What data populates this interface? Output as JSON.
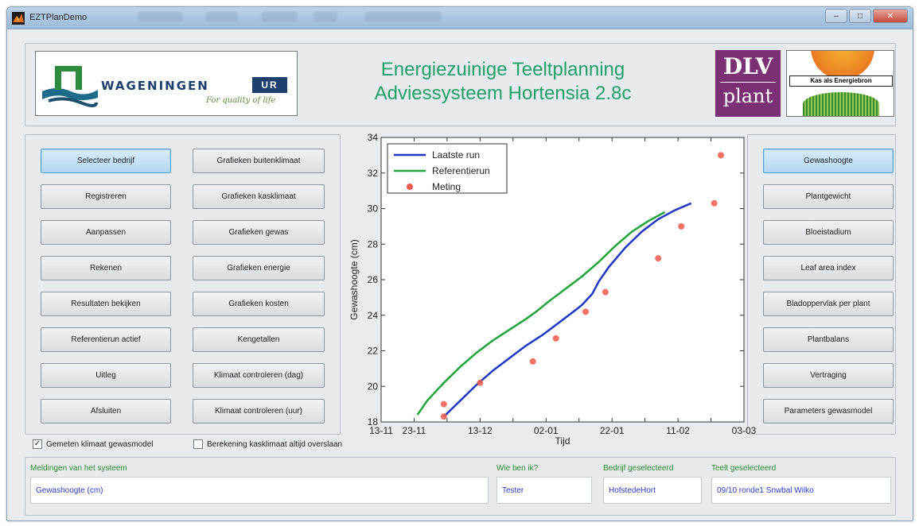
{
  "window": {
    "title": "EZTPlanDemo"
  },
  "banner": {
    "wur_logo": {
      "name": "WAGENINGEN",
      "suffix": "UR",
      "tagline": "For quality of life"
    },
    "title_line1": "Energiezuinige Teeltplanning",
    "title_line2": "Adviessysteem Hortensia 2.8c",
    "dlv_logo": {
      "top": "DLV",
      "bottom": "plant"
    },
    "kas_logo": {
      "label": "Kas als Energiebron"
    }
  },
  "left_buttons": [
    {
      "label": "Selecteer bedrijf",
      "active": true
    },
    {
      "label": "Registreren"
    },
    {
      "label": "Aanpassen"
    },
    {
      "label": "Rekenen"
    },
    {
      "label": "Resultaten bekijken"
    },
    {
      "label": "Referentierun actief"
    },
    {
      "label": "Uitleg"
    },
    {
      "label": "Afsluiten"
    }
  ],
  "mid_buttons": [
    {
      "label": "Grafieken buitenklimaat"
    },
    {
      "label": "Grafieken kasklimaat"
    },
    {
      "label": "Grafieken gewas"
    },
    {
      "label": "Grafieken energie"
    },
    {
      "label": "Grafieken kosten"
    },
    {
      "label": "Kengetallen"
    },
    {
      "label": "Klimaat controleren (dag)"
    },
    {
      "label": "Klimaat controleren (uur)"
    }
  ],
  "right_buttons": [
    {
      "label": "Gewashoogte",
      "active": true
    },
    {
      "label": "Plantgewicht"
    },
    {
      "label": "Bloeistadium"
    },
    {
      "label": "Leaf area index"
    },
    {
      "label": "Bladoppervlak per plant"
    },
    {
      "label": "Plantbalans"
    },
    {
      "label": "Vertraging"
    },
    {
      "label": "Parameters gewasmodel"
    }
  ],
  "checkboxes": [
    {
      "label": "Gemeten klimaat gewasmodel",
      "checked": true,
      "mark": "✓"
    },
    {
      "label": "Berekening kasklimaat altijd overslaan",
      "checked": false,
      "mark": ""
    }
  ],
  "status": {
    "messages_label": "Meldingen van het systeem",
    "messages_value": "Gewashoogte (cm)",
    "user_label": "Wie ben ik?",
    "user_value": "Tester",
    "company_label": "Bedrijf geselecteerd",
    "company_value": "HofstedeHort",
    "crop_label": "Teelt geselecteerd",
    "crop_value": "09/10 ronde1 Snwbal Wilko"
  },
  "chart_data": {
    "type": "line",
    "xlabel": "Tijd",
    "ylabel": "Gewashoogte (cm)",
    "x_ticks": [
      "13-11",
      "23-11",
      "03-12",
      "13-12",
      "23-12",
      "02-01",
      "12-01",
      "22-01",
      "01-02",
      "11-02",
      "21-02",
      "03-03"
    ],
    "x_tick_labels_shown": [
      "13-11",
      "23-11",
      "13-12",
      "02-01",
      "22-01",
      "11-02",
      "03-03"
    ],
    "xlim": [
      "13-11",
      "03-03"
    ],
    "ylim": [
      18,
      34
    ],
    "y_ticks": [
      18,
      20,
      22,
      24,
      26,
      28,
      30,
      32,
      34
    ],
    "grid": false,
    "legend_position": "top-left",
    "series": [
      {
        "name": "Laatste run",
        "style": "line",
        "color": "#1f36c2",
        "points": [
          [
            "02-12",
            18.3
          ],
          [
            "07-12",
            19.2
          ],
          [
            "12-12",
            20.1
          ],
          [
            "17-12",
            20.9
          ],
          [
            "22-12",
            21.6
          ],
          [
            "27-12",
            22.3
          ],
          [
            "01-01",
            22.9
          ],
          [
            "06-01",
            23.6
          ],
          [
            "11-01",
            24.3
          ],
          [
            "13-01",
            24.6
          ],
          [
            "16-01",
            25.2
          ],
          [
            "18-01",
            25.9
          ],
          [
            "21-01",
            26.7
          ],
          [
            "26-01",
            27.8
          ],
          [
            "31-01",
            28.7
          ],
          [
            "05-02",
            29.4
          ],
          [
            "10-02",
            29.9
          ],
          [
            "15-02",
            30.3
          ]
        ]
      },
      {
        "name": "Referentierun",
        "style": "line",
        "color": "#1fa33a",
        "points": [
          [
            "24-11",
            18.4
          ],
          [
            "27-11",
            19.2
          ],
          [
            "02-12",
            20.2
          ],
          [
            "07-12",
            21.1
          ],
          [
            "12-12",
            21.9
          ],
          [
            "17-12",
            22.6
          ],
          [
            "22-12",
            23.2
          ],
          [
            "27-12",
            23.8
          ],
          [
            "30-12",
            24.2
          ],
          [
            "03-01",
            24.8
          ],
          [
            "08-01",
            25.5
          ],
          [
            "13-01",
            26.2
          ],
          [
            "18-01",
            27.0
          ],
          [
            "23-01",
            27.9
          ],
          [
            "28-01",
            28.7
          ],
          [
            "02-02",
            29.3
          ],
          [
            "07-02",
            29.8
          ]
        ]
      },
      {
        "name": "Meting",
        "style": "markers",
        "color": "#f05a4a",
        "points": [
          [
            "02-12",
            19.0
          ],
          [
            "02-12",
            18.3
          ],
          [
            "13-12",
            20.2
          ],
          [
            "29-12",
            21.4
          ],
          [
            "05-01",
            22.7
          ],
          [
            "14-01",
            24.2
          ],
          [
            "20-01",
            25.3
          ],
          [
            "05-02",
            27.2
          ],
          [
            "12-02",
            29.0
          ],
          [
            "22-02",
            30.3
          ],
          [
            "24-02",
            33.0
          ]
        ]
      }
    ]
  }
}
